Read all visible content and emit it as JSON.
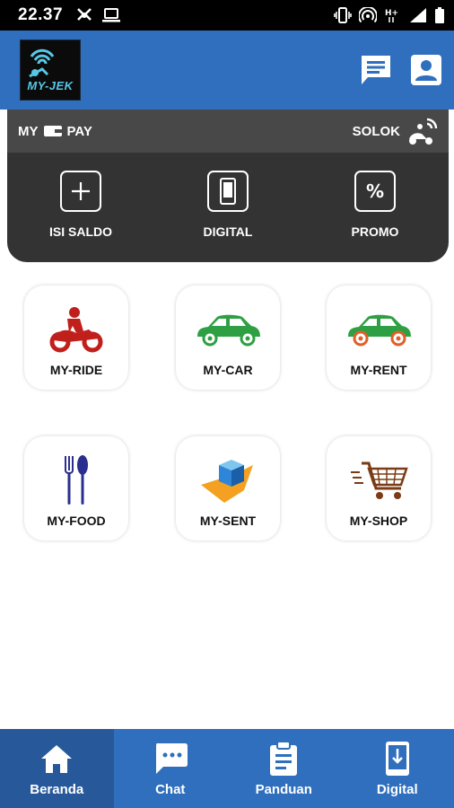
{
  "status_bar": {
    "time": "22.37"
  },
  "app": {
    "logo_text": "MY-JEK"
  },
  "wallet": {
    "brand_left": "MY",
    "brand_right": "PAY",
    "city": "SOLOK",
    "actions": [
      {
        "label": "ISI SALDO",
        "icon": "plus-icon"
      },
      {
        "label": "DIGITAL",
        "icon": "phone-icon"
      },
      {
        "label": "PROMO",
        "icon": "percent-icon"
      }
    ]
  },
  "services": [
    {
      "label": "MY-RIDE",
      "icon": "motorbike-icon"
    },
    {
      "label": "MY-CAR",
      "icon": "car-icon"
    },
    {
      "label": "MY-RENT",
      "icon": "rental-car-icon"
    },
    {
      "label": "MY-FOOD",
      "icon": "cutlery-icon"
    },
    {
      "label": "MY-SENT",
      "icon": "package-icon"
    },
    {
      "label": "MY-SHOP",
      "icon": "shopping-cart-icon"
    }
  ],
  "bottom_nav": [
    {
      "label": "Beranda",
      "icon": "home-icon",
      "active": true
    },
    {
      "label": "Chat",
      "icon": "chat-icon"
    },
    {
      "label": "Panduan",
      "icon": "clipboard-icon"
    },
    {
      "label": "Digital",
      "icon": "phone-download-icon"
    }
  ],
  "colors": {
    "primary": "#2f6fbd",
    "primary_dark": "#27599a",
    "wallet_bg": "#333333",
    "ride_red": "#c0201c",
    "car_green": "#2ea043"
  }
}
